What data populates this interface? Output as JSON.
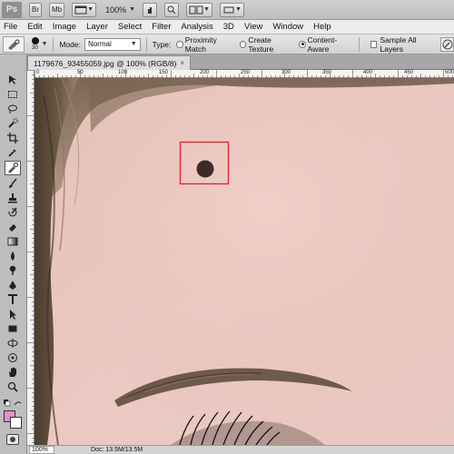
{
  "app": {
    "logo": "Ps"
  },
  "appbar": {
    "bridge_label": "Br",
    "minibridge_label": "Mb",
    "zoom_level": "100%"
  },
  "menu": {
    "items": [
      "File",
      "Edit",
      "Image",
      "Layer",
      "Select",
      "Filter",
      "Analysis",
      "3D",
      "View",
      "Window",
      "Help"
    ]
  },
  "options": {
    "brush_size": "30",
    "mode_label": "Mode:",
    "mode_value": "Normal",
    "type_label": "Type:",
    "type_options": [
      "Proximity Match",
      "Create Texture",
      "Content-Aware"
    ],
    "selected_type": "Content-Aware",
    "sample_all_layers": "Sample All Layers"
  },
  "document": {
    "tab_title": "1179676_93455059.jpg @ 100% (RGB/8)",
    "close_glyph": "×"
  },
  "ruler": {
    "top_labels": [
      "0",
      "50",
      "100",
      "150",
      "200",
      "250",
      "300",
      "350",
      "400",
      "450",
      "500"
    ]
  },
  "status": {
    "zoom": "100%",
    "doc_info": "Doc: 13.5M/13.5M"
  },
  "colors": {
    "foreground": "#e28fc9",
    "background": "#ffffff",
    "highlight_box": "#e0202a",
    "blemish": "#3a2d28"
  }
}
